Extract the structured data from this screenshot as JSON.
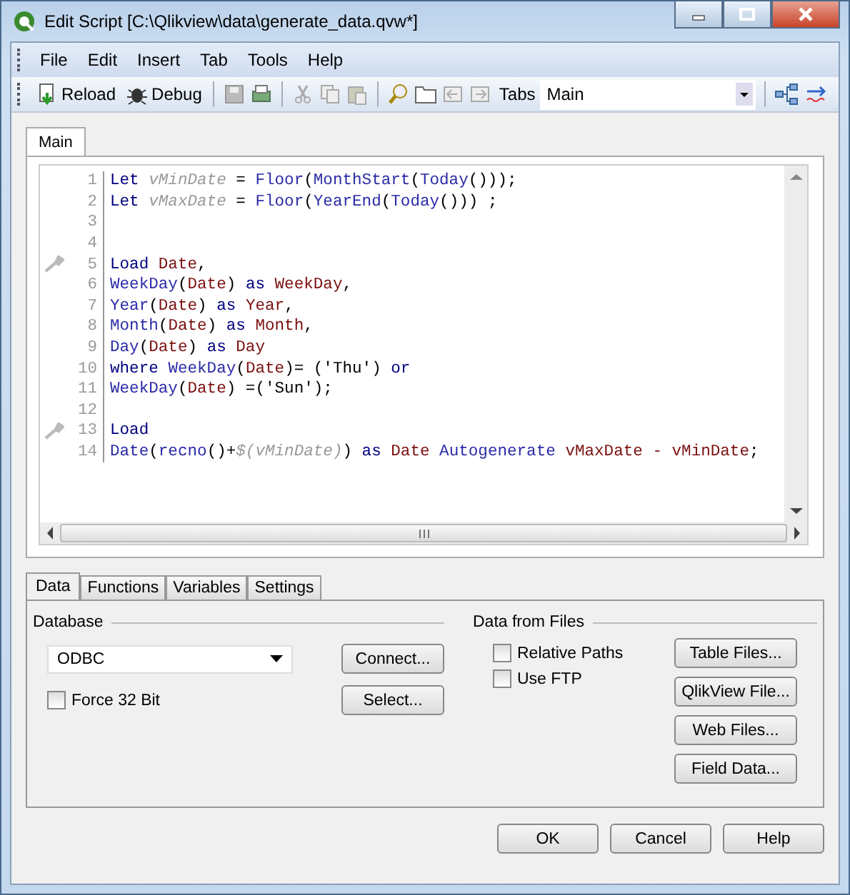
{
  "window": {
    "title": "Edit Script [C:\\Qlikview\\data\\generate_data.qvw*]"
  },
  "menu": [
    "File",
    "Edit",
    "Insert",
    "Tab",
    "Tools",
    "Help"
  ],
  "toolbar": {
    "reload": "Reload",
    "debug": "Debug",
    "tabs_label": "Tabs",
    "tabs_value": "Main"
  },
  "script_tabs": [
    {
      "label": "Main",
      "selected": true
    }
  ],
  "code_lines": [
    {
      "number": "1",
      "marked": false,
      "tokens": [
        {
          "kind": "keyword",
          "text": "Let "
        },
        {
          "kind": "variable",
          "text": "vMinDate"
        },
        {
          "kind": "plain",
          "text": " = "
        },
        {
          "kind": "function",
          "text": "Floor"
        },
        {
          "kind": "plain",
          "text": "("
        },
        {
          "kind": "function",
          "text": "MonthStart"
        },
        {
          "kind": "plain",
          "text": "("
        },
        {
          "kind": "function",
          "text": "Today"
        },
        {
          "kind": "plain",
          "text": "()));"
        }
      ]
    },
    {
      "number": "2",
      "marked": false,
      "tokens": [
        {
          "kind": "keyword",
          "text": "Let "
        },
        {
          "kind": "variable",
          "text": "vMaxDate"
        },
        {
          "kind": "plain",
          "text": " = "
        },
        {
          "kind": "function",
          "text": "Floor"
        },
        {
          "kind": "plain",
          "text": "("
        },
        {
          "kind": "function",
          "text": "YearEnd"
        },
        {
          "kind": "plain",
          "text": "("
        },
        {
          "kind": "function",
          "text": "Today"
        },
        {
          "kind": "plain",
          "text": "())) ;"
        }
      ]
    },
    {
      "number": "3",
      "marked": false
    },
    {
      "number": "4",
      "marked": false
    },
    {
      "number": "5",
      "marked": true,
      "tokens": [
        {
          "kind": "keyword",
          "text": "Load "
        },
        {
          "kind": "field",
          "text": "Date"
        },
        {
          "kind": "plain",
          "text": ","
        }
      ]
    },
    {
      "number": "6",
      "marked": false,
      "tokens": [
        {
          "kind": "function",
          "text": "WeekDay"
        },
        {
          "kind": "plain",
          "text": "("
        },
        {
          "kind": "field",
          "text": "Date"
        },
        {
          "kind": "plain",
          "text": ") "
        },
        {
          "kind": "keyword",
          "text": "as "
        },
        {
          "kind": "field",
          "text": "WeekDay"
        },
        {
          "kind": "plain",
          "text": ","
        }
      ]
    },
    {
      "number": "7",
      "marked": false,
      "tokens": [
        {
          "kind": "function",
          "text": "Year"
        },
        {
          "kind": "plain",
          "text": "("
        },
        {
          "kind": "field",
          "text": "Date"
        },
        {
          "kind": "plain",
          "text": ") "
        },
        {
          "kind": "keyword",
          "text": "as "
        },
        {
          "kind": "field",
          "text": "Year"
        },
        {
          "kind": "plain",
          "text": ","
        }
      ]
    },
    {
      "number": "8",
      "marked": false,
      "tokens": [
        {
          "kind": "function",
          "text": "Month"
        },
        {
          "kind": "plain",
          "text": "("
        },
        {
          "kind": "field",
          "text": "Date"
        },
        {
          "kind": "plain",
          "text": ") "
        },
        {
          "kind": "keyword",
          "text": "as "
        },
        {
          "kind": "field",
          "text": "Month"
        },
        {
          "kind": "plain",
          "text": ","
        }
      ]
    },
    {
      "number": "9",
      "marked": false,
      "tokens": [
        {
          "kind": "function",
          "text": "Day"
        },
        {
          "kind": "plain",
          "text": "("
        },
        {
          "kind": "field",
          "text": "Date"
        },
        {
          "kind": "plain",
          "text": ") "
        },
        {
          "kind": "keyword",
          "text": "as "
        },
        {
          "kind": "field",
          "text": "Day"
        }
      ]
    },
    {
      "number": "10",
      "marked": false,
      "tokens": [
        {
          "kind": "keyword",
          "text": "where "
        },
        {
          "kind": "function",
          "text": "WeekDay"
        },
        {
          "kind": "plain",
          "text": "("
        },
        {
          "kind": "field",
          "text": "Date"
        },
        {
          "kind": "plain",
          "text": ")= ('Thu') "
        },
        {
          "kind": "keyword",
          "text": "or"
        }
      ]
    },
    {
      "number": "11",
      "marked": false,
      "tokens": [
        {
          "kind": "function",
          "text": "WeekDay"
        },
        {
          "kind": "plain",
          "text": "("
        },
        {
          "kind": "field",
          "text": "Date"
        },
        {
          "kind": "plain",
          "text": ") =('Sun');"
        }
      ]
    },
    {
      "number": "12",
      "marked": false
    },
    {
      "number": "13",
      "marked": true,
      "tokens": [
        {
          "kind": "keyword",
          "text": "Load"
        }
      ]
    },
    {
      "number": "14",
      "marked": false,
      "tokens": [
        {
          "kind": "function",
          "text": "Date"
        },
        {
          "kind": "plain",
          "text": "("
        },
        {
          "kind": "function",
          "text": "recno"
        },
        {
          "kind": "plain",
          "text": "()+"
        },
        {
          "kind": "variable",
          "text": "$(vMinDate)"
        },
        {
          "kind": "plain",
          "text": ") "
        },
        {
          "kind": "keyword",
          "text": "as "
        },
        {
          "kind": "field",
          "text": "Date "
        },
        {
          "kind": "function",
          "text": "Autogenerate "
        },
        {
          "kind": "field",
          "text": "vMaxDate - vMinDate"
        },
        {
          "kind": "plain",
          "text": ";"
        }
      ]
    }
  ],
  "bottom_tabs": [
    {
      "label": "Data",
      "selected": true
    },
    {
      "label": "Functions",
      "selected": false
    },
    {
      "label": "Variables",
      "selected": false
    },
    {
      "label": "Settings",
      "selected": false
    }
  ],
  "database": {
    "title": "Database",
    "value": "ODBC",
    "force_32_bit": {
      "label": "Force 32 Bit",
      "checked": false
    },
    "buttons": [
      "Connect...",
      "Select..."
    ]
  },
  "data_from_files": {
    "title": "Data from Files",
    "options": [
      {
        "label": "Relative Paths",
        "checked": false
      },
      {
        "label": "Use FTP",
        "checked": false
      }
    ],
    "buttons": [
      "Table Files...",
      "QlikView File...",
      "Web Files...",
      "Field Data..."
    ]
  },
  "buttons": [
    "OK",
    "Cancel",
    "Help"
  ]
}
